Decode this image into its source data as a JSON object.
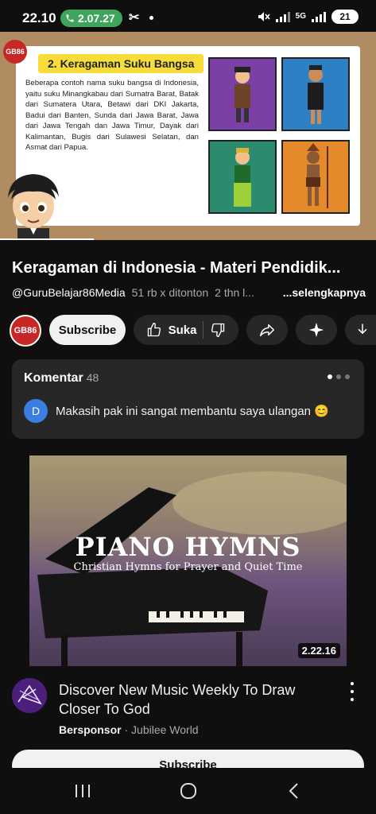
{
  "status_bar": {
    "time": "22.10",
    "call_duration": "2.07.27",
    "network": "5G",
    "battery": "21"
  },
  "video": {
    "slide_title": "2. Keragaman Suku Bangsa",
    "slide_text": "Beberapa contoh nama suku bangsa di Indonesia, yaitu suku Minangkabau dari Sumatra Barat, Batak dari Sumatera Utara, Betawi dari DKI Jakarta, Badui dari Banten, Sunda dari Jawa Barat, Jawa dari Jawa Tengah dan Jawa Timur, Dayak dari Kalimantan, Bugis dari Sulawesi Selatan, dan Asmat dari Papua.",
    "channel_logo_text": "GB86",
    "progress_fraction": 0.25,
    "tile_colors": [
      "#7b3fa6",
      "#2f7fc4",
      "#2c8a6e",
      "#e48a2a"
    ]
  },
  "info": {
    "title": "Keragaman di Indonesia - Materi Pendidik...",
    "handle": "@GuruBelajar86Media",
    "views": "51 rb x ditonton",
    "age": "2 thn l...",
    "more": "...selengkapnya"
  },
  "actions": {
    "channel_avatar": "GB86",
    "subscribe": "Subscribe",
    "like": "Suka"
  },
  "comments": {
    "heading": "Komentar",
    "count": "48",
    "avatar_letter": "D",
    "top_comment": "Makasih pak ini sangat membantu saya ulangan 😊"
  },
  "ad": {
    "thumb_title": "PIANO HYMNS",
    "thumb_subtitle": "Christian Hymns for Prayer and Quiet Time",
    "duration": "2.22.16",
    "title": "Discover New Music Weekly To Draw Closer To God",
    "sponsor_label": "Bersponsor",
    "advertiser": "Jubilee World",
    "subscribe": "Subscribe"
  },
  "colors": {
    "background": "#0f0f0f",
    "chip": "#272727",
    "call_green": "#3ea55b",
    "brand_red": "#c62828"
  }
}
